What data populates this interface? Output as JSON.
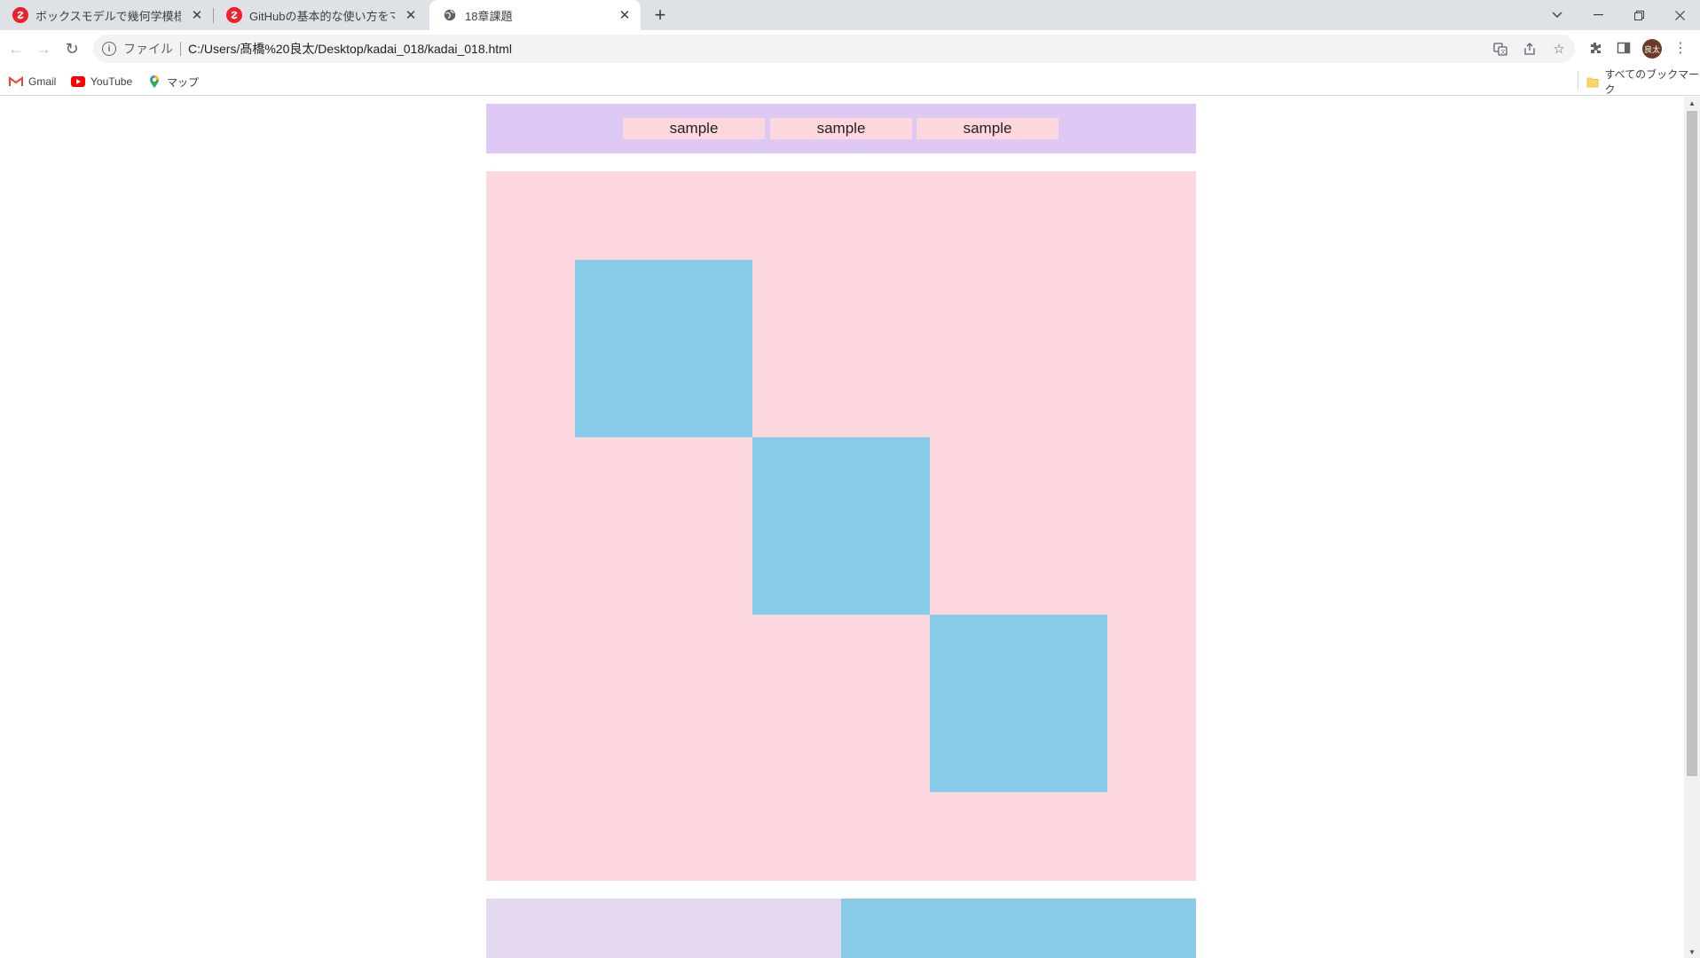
{
  "tabs": [
    {
      "title": "ボックスモデルで幾何学模様のページ",
      "favicon": "samurai-logo-icon"
    },
    {
      "title": "GitHubの基本的な使い方をマスター",
      "favicon": "samurai-logo-icon"
    },
    {
      "title": "18章課題",
      "favicon": "globe-icon",
      "active": true
    }
  ],
  "address": {
    "scheme_label": "ファイル",
    "url": "C:/Users/髙橋%20良太/Desktop/kadai_018/kadai_018.html"
  },
  "profile": {
    "avatar_text": "良太"
  },
  "bookmarks": {
    "items": [
      {
        "label": "Gmail"
      },
      {
        "label": "YouTube"
      },
      {
        "label": "マップ"
      }
    ],
    "all_bookmarks_label": "すべてのブックマーク"
  },
  "page": {
    "nav_links": [
      "sample",
      "sample",
      "sample"
    ],
    "colors": {
      "header_bg": "#ddc9f3",
      "link_bg": "#fdd7de",
      "main_bg": "#fdd7de",
      "box": "#89cce9",
      "footer_left": "#e4d9ee",
      "footer_right": "#89cce9"
    }
  }
}
